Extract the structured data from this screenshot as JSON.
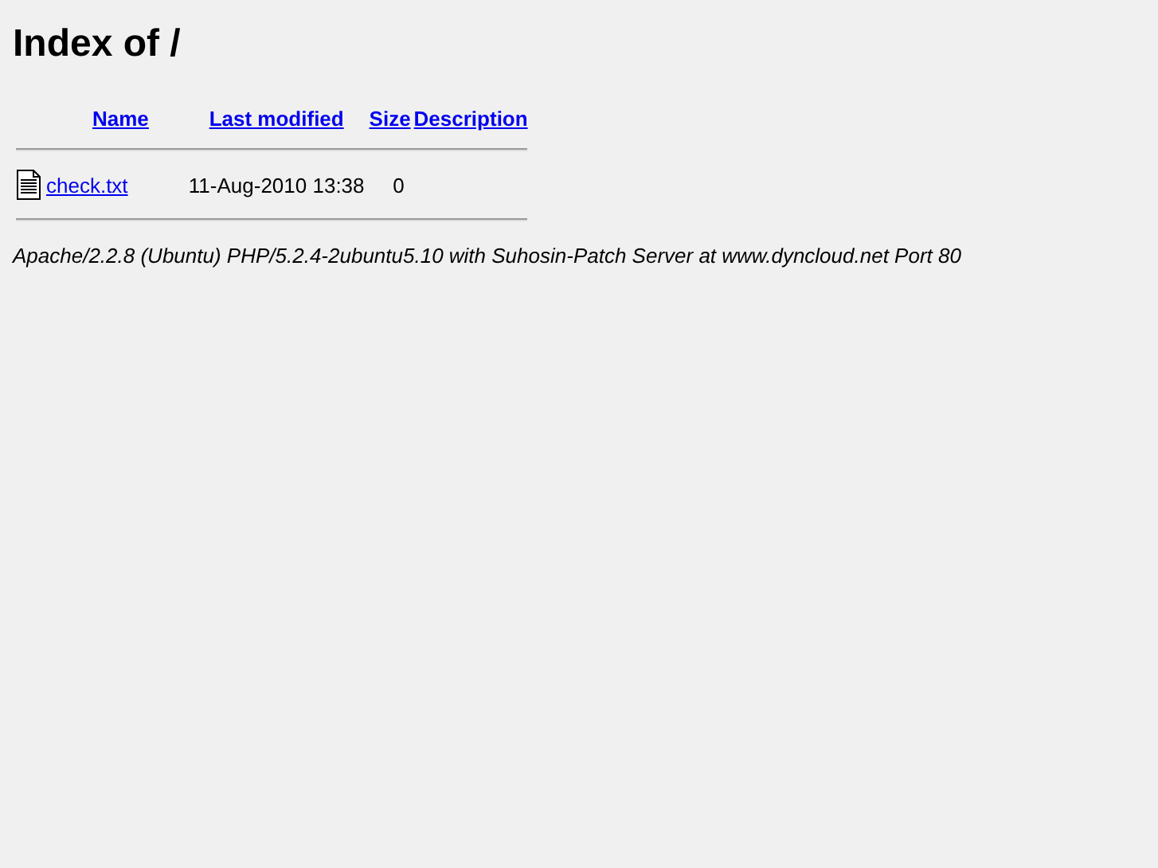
{
  "title": "Index of /",
  "columns": [
    "Name",
    "Last modified",
    "Size",
    "Description"
  ],
  "rows": [
    {
      "kind": "text",
      "name": "check.txt",
      "modified": "11-Aug-2010 13:38",
      "size": "0"
    }
  ],
  "footer": "Apache/2.2.8 (Ubuntu) PHP/5.2.4-2ubuntu5.10 with Suhosin-Patch Server at www.dyncloud.net Port 80"
}
